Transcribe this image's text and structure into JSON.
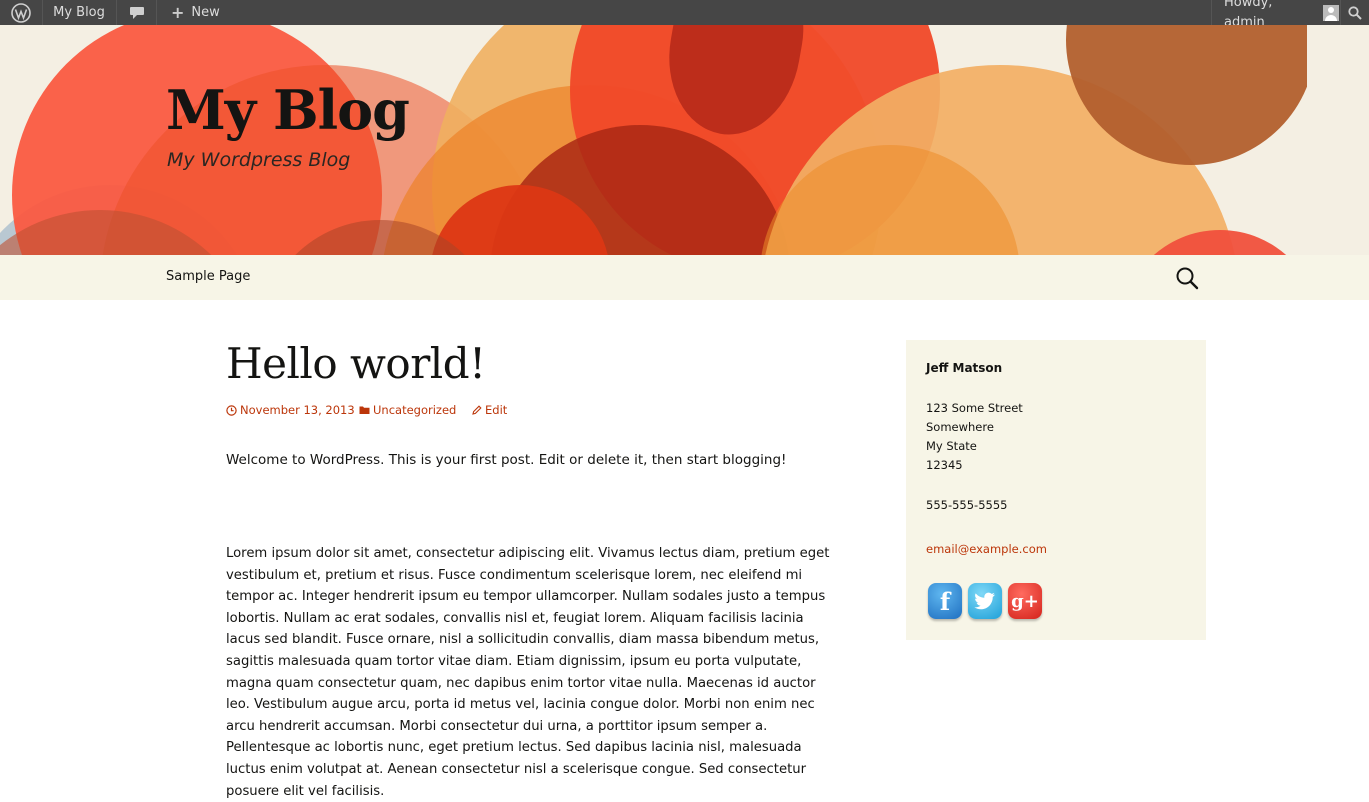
{
  "adminbar": {
    "site_name": "My Blog",
    "new_label": "New",
    "howdy": "Howdy, admin"
  },
  "header": {
    "title": "My Blog",
    "description": "My Wordpress Blog"
  },
  "nav": {
    "items": [
      {
        "label": "Sample Page"
      }
    ]
  },
  "post": {
    "title": "Hello world!",
    "date": "November 13, 2013",
    "category": "Uncategorized",
    "edit_label": "Edit",
    "intro": "Welcome to WordPress. This is your first post. Edit or delete it, then start blogging!",
    "body": "Lorem ipsum dolor sit amet, consectetur adipiscing elit. Vivamus lectus diam, pretium eget vestibulum et, pretium et risus. Fusce condimentum scelerisque lorem, nec eleifend mi tempor ac. Integer hendrerit ipsum eu tempor ullamcorper. Nullam sodales justo a tempus lobortis. Nullam ac erat sodales, convallis nisl et, feugiat lorem. Aliquam facilisis lacinia lacus sed blandit. Fusce ornare, nisl a sollicitudin convallis, diam massa bibendum metus, sagittis malesuada quam tortor vitae diam. Etiam dignissim, ipsum eu porta vulputate, magna quam consectetur quam, nec dapibus enim tortor vitae nulla. Maecenas id auctor leo. Vestibulum augue arcu, porta id metus vel, lacinia congue dolor. Morbi non enim nec arcu hendrerit accumsan. Morbi consectetur dui urna, a porttitor ipsum semper a. Pellentesque ac lobortis nunc, eget pretium lectus. Sed dapibus lacinia nisl, malesuada luctus enim volutpat at. Aenean consectetur nisl a scelerisque congue. Sed consectetur posuere elit vel facilisis."
  },
  "sidebar": {
    "name": "Jeff Matson",
    "address": [
      "123 Some Street",
      "Somewhere",
      "My State",
      "12345"
    ],
    "phone": "555-555-5555",
    "email": "email@example.com",
    "social": [
      {
        "icon": "facebook-icon",
        "glyph": "f"
      },
      {
        "icon": "twitter-icon",
        "glyph": "t"
      },
      {
        "icon": "google-plus-icon",
        "glyph": "g+"
      }
    ]
  },
  "colors": {
    "link": "#bc360a",
    "adminbar_bg": "#464646",
    "nav_bg": "#f7f5e7",
    "sidebar_bg": "#f7f5e7"
  }
}
